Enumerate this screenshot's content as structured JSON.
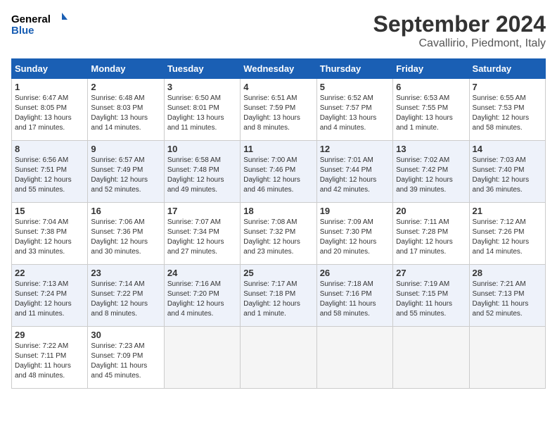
{
  "header": {
    "logo_line1": "General",
    "logo_line2": "Blue",
    "title": "September 2024",
    "subtitle": "Cavallirio, Piedmont, Italy"
  },
  "columns": [
    "Sunday",
    "Monday",
    "Tuesday",
    "Wednesday",
    "Thursday",
    "Friday",
    "Saturday"
  ],
  "weeks": [
    [
      {
        "day": 1,
        "info": "Sunrise: 6:47 AM\nSunset: 8:05 PM\nDaylight: 13 hours\nand 17 minutes."
      },
      {
        "day": 2,
        "info": "Sunrise: 6:48 AM\nSunset: 8:03 PM\nDaylight: 13 hours\nand 14 minutes."
      },
      {
        "day": 3,
        "info": "Sunrise: 6:50 AM\nSunset: 8:01 PM\nDaylight: 13 hours\nand 11 minutes."
      },
      {
        "day": 4,
        "info": "Sunrise: 6:51 AM\nSunset: 7:59 PM\nDaylight: 13 hours\nand 8 minutes."
      },
      {
        "day": 5,
        "info": "Sunrise: 6:52 AM\nSunset: 7:57 PM\nDaylight: 13 hours\nand 4 minutes."
      },
      {
        "day": 6,
        "info": "Sunrise: 6:53 AM\nSunset: 7:55 PM\nDaylight: 13 hours\nand 1 minute."
      },
      {
        "day": 7,
        "info": "Sunrise: 6:55 AM\nSunset: 7:53 PM\nDaylight: 12 hours\nand 58 minutes."
      }
    ],
    [
      {
        "day": 8,
        "info": "Sunrise: 6:56 AM\nSunset: 7:51 PM\nDaylight: 12 hours\nand 55 minutes."
      },
      {
        "day": 9,
        "info": "Sunrise: 6:57 AM\nSunset: 7:49 PM\nDaylight: 12 hours\nand 52 minutes."
      },
      {
        "day": 10,
        "info": "Sunrise: 6:58 AM\nSunset: 7:48 PM\nDaylight: 12 hours\nand 49 minutes."
      },
      {
        "day": 11,
        "info": "Sunrise: 7:00 AM\nSunset: 7:46 PM\nDaylight: 12 hours\nand 46 minutes."
      },
      {
        "day": 12,
        "info": "Sunrise: 7:01 AM\nSunset: 7:44 PM\nDaylight: 12 hours\nand 42 minutes."
      },
      {
        "day": 13,
        "info": "Sunrise: 7:02 AM\nSunset: 7:42 PM\nDaylight: 12 hours\nand 39 minutes."
      },
      {
        "day": 14,
        "info": "Sunrise: 7:03 AM\nSunset: 7:40 PM\nDaylight: 12 hours\nand 36 minutes."
      }
    ],
    [
      {
        "day": 15,
        "info": "Sunrise: 7:04 AM\nSunset: 7:38 PM\nDaylight: 12 hours\nand 33 minutes."
      },
      {
        "day": 16,
        "info": "Sunrise: 7:06 AM\nSunset: 7:36 PM\nDaylight: 12 hours\nand 30 minutes."
      },
      {
        "day": 17,
        "info": "Sunrise: 7:07 AM\nSunset: 7:34 PM\nDaylight: 12 hours\nand 27 minutes."
      },
      {
        "day": 18,
        "info": "Sunrise: 7:08 AM\nSunset: 7:32 PM\nDaylight: 12 hours\nand 23 minutes."
      },
      {
        "day": 19,
        "info": "Sunrise: 7:09 AM\nSunset: 7:30 PM\nDaylight: 12 hours\nand 20 minutes."
      },
      {
        "day": 20,
        "info": "Sunrise: 7:11 AM\nSunset: 7:28 PM\nDaylight: 12 hours\nand 17 minutes."
      },
      {
        "day": 21,
        "info": "Sunrise: 7:12 AM\nSunset: 7:26 PM\nDaylight: 12 hours\nand 14 minutes."
      }
    ],
    [
      {
        "day": 22,
        "info": "Sunrise: 7:13 AM\nSunset: 7:24 PM\nDaylight: 12 hours\nand 11 minutes."
      },
      {
        "day": 23,
        "info": "Sunrise: 7:14 AM\nSunset: 7:22 PM\nDaylight: 12 hours\nand 8 minutes."
      },
      {
        "day": 24,
        "info": "Sunrise: 7:16 AM\nSunset: 7:20 PM\nDaylight: 12 hours\nand 4 minutes."
      },
      {
        "day": 25,
        "info": "Sunrise: 7:17 AM\nSunset: 7:18 PM\nDaylight: 12 hours\nand 1 minute."
      },
      {
        "day": 26,
        "info": "Sunrise: 7:18 AM\nSunset: 7:16 PM\nDaylight: 11 hours\nand 58 minutes."
      },
      {
        "day": 27,
        "info": "Sunrise: 7:19 AM\nSunset: 7:15 PM\nDaylight: 11 hours\nand 55 minutes."
      },
      {
        "day": 28,
        "info": "Sunrise: 7:21 AM\nSunset: 7:13 PM\nDaylight: 11 hours\nand 52 minutes."
      }
    ],
    [
      {
        "day": 29,
        "info": "Sunrise: 7:22 AM\nSunset: 7:11 PM\nDaylight: 11 hours\nand 48 minutes."
      },
      {
        "day": 30,
        "info": "Sunrise: 7:23 AM\nSunset: 7:09 PM\nDaylight: 11 hours\nand 45 minutes."
      },
      null,
      null,
      null,
      null,
      null
    ]
  ]
}
